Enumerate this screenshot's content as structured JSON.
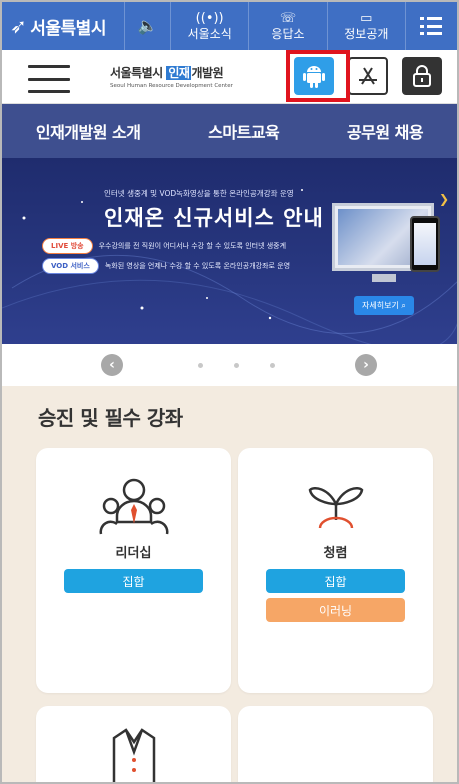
{
  "citybar": {
    "logo": "서울특별시",
    "items": [
      {
        "label": "",
        "icon": "speaker-icon"
      },
      {
        "label": "서울소식",
        "icon": "broadcast-icon"
      },
      {
        "label": "응답소",
        "icon": "phone-icon"
      },
      {
        "label": "정보공개",
        "icon": "folder-icon"
      },
      {
        "label": "",
        "icon": "list-menu-icon"
      }
    ]
  },
  "header": {
    "brand_ko_prefix": "서울특별시",
    "brand_ko_highlight": "인재",
    "brand_ko_suffix": "개발원",
    "brand_en": "Seoul Human Resource Development Center"
  },
  "nav": {
    "items": [
      "인재개발원 소개",
      "스마트교육",
      "공무원 채용"
    ]
  },
  "banner": {
    "subtitle": "인터넷 생중계 및 VOD녹화영상을 통한 온라인공개강좌 운영",
    "title": "인재온 신규서비스 안내",
    "live_label": "LIVE 방송",
    "live_text": "우수강의를 전 직원이 어디서나 수강 할 수 있도록 인터넷 생중계",
    "vod_label": "VOD 서비스",
    "vod_text": "녹화된 영상을 언제나 수강 할 수 있도록 온라인공개강좌로 운영",
    "more": "자세히보기"
  },
  "section": {
    "title": "승진 및 필수 강좌",
    "cards": [
      {
        "label": "리더십",
        "tags": [
          "집합"
        ]
      },
      {
        "label": "청렴",
        "tags": [
          "집합",
          "이러닝"
        ]
      }
    ]
  },
  "colors": {
    "citybar": "#3f6fc4",
    "nav": "#3e4f8f",
    "tag_blue": "#1fa3e0",
    "tag_orange": "#f6a666",
    "highlight_red": "#e0141e"
  }
}
